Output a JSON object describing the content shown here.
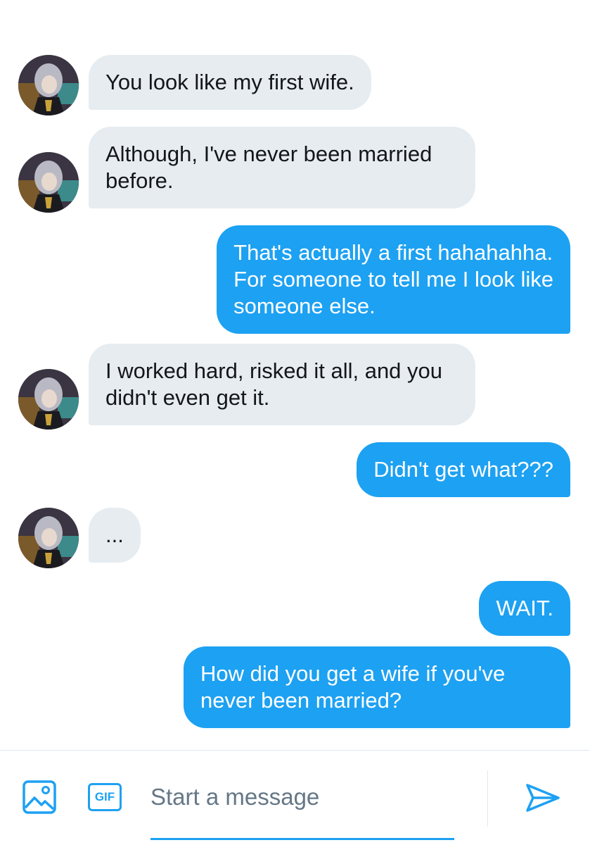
{
  "conversation": {
    "messages": [
      {
        "side": "received",
        "text": "You look like my first wife."
      },
      {
        "side": "received",
        "text": "Although, I've never been married\nbefore."
      },
      {
        "side": "sent",
        "text": "That's actually a first hahahahha.\nFor someone to tell me I look like\nsomeone else."
      },
      {
        "side": "received",
        "text": "I worked hard, risked it all, and you\ndidn't even get it."
      },
      {
        "side": "sent",
        "text": "Didn't get what???"
      },
      {
        "side": "received",
        "text": "..."
      },
      {
        "side": "sent",
        "text": "WAIT."
      },
      {
        "side": "sent",
        "text": "How did you get a wife if you've\nnever been married?"
      }
    ]
  },
  "composer": {
    "gif_label": "GIF",
    "placeholder": "Start a message",
    "value": ""
  },
  "colors": {
    "accent": "#1da1f2",
    "received_bubble": "#e6ecf0",
    "received_text": "#14171a",
    "sent_text": "#ffffff"
  },
  "icons": {
    "image": "image-icon",
    "gif": "gif-icon",
    "send": "send-icon",
    "avatar": "avatar"
  }
}
